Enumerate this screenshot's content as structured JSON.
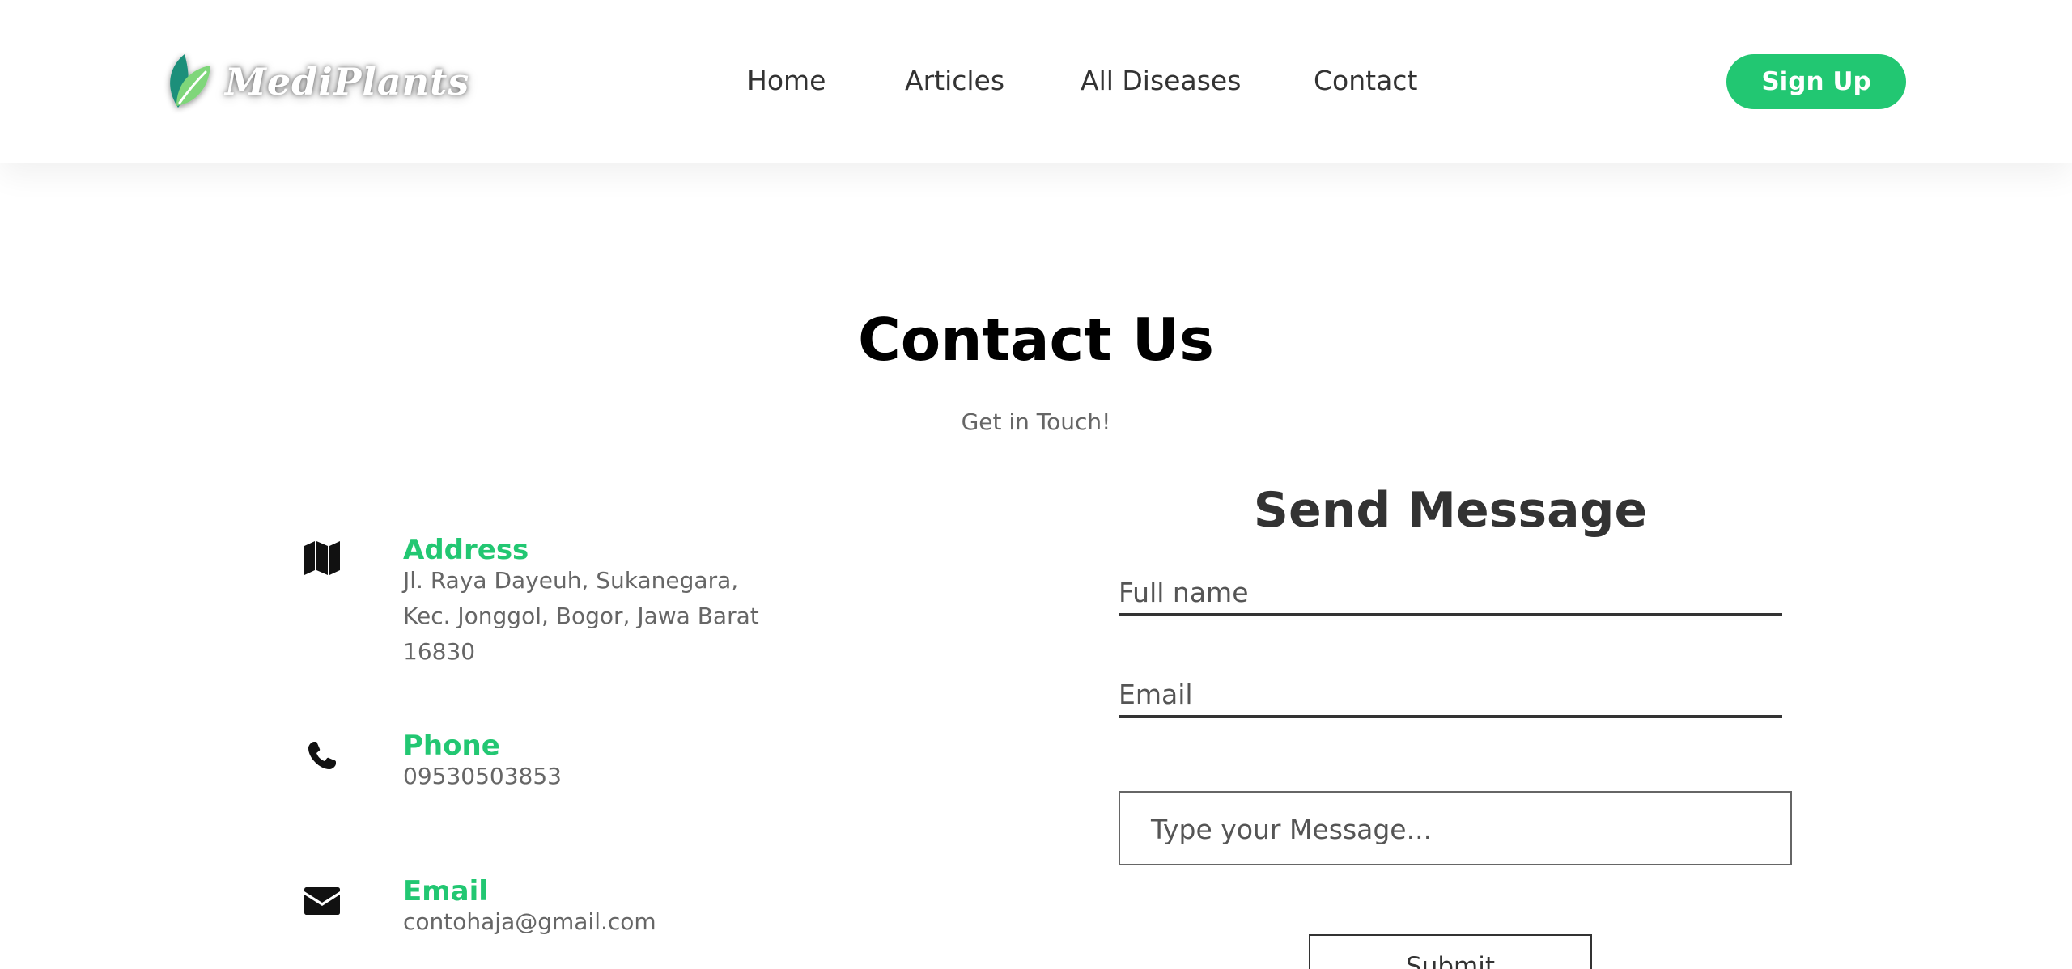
{
  "brand": {
    "name": "MediPlants",
    "logo_icon": "leaf-icon",
    "accent_color": "#22c772"
  },
  "nav": {
    "items": [
      {
        "label": "Home"
      },
      {
        "label": "Articles"
      },
      {
        "label": "All Diseases"
      },
      {
        "label": "Contact"
      }
    ],
    "signup_label": "Sign Up"
  },
  "main": {
    "title": "Contact Us",
    "subtitle": "Get in Touch!"
  },
  "contact_info": {
    "address": {
      "icon": "map-icon",
      "label": "Address",
      "line1": "Jl. Raya Dayeuh, Sukanegara,",
      "line2": "Kec. Jonggol, Bogor, Jawa Barat",
      "line3": "16830"
    },
    "phone": {
      "icon": "phone-icon",
      "label": "Phone",
      "value": "09530503853"
    },
    "email": {
      "icon": "envelope-icon",
      "label": "Email",
      "value": "contohaja@gmail.com"
    }
  },
  "form": {
    "title": "Send Message",
    "full_name": {
      "value": "",
      "placeholder": "Full name"
    },
    "email": {
      "value": "",
      "placeholder": "Email"
    },
    "message": {
      "value": "",
      "placeholder": "Type your Message..."
    },
    "submit_label": "Submit"
  }
}
